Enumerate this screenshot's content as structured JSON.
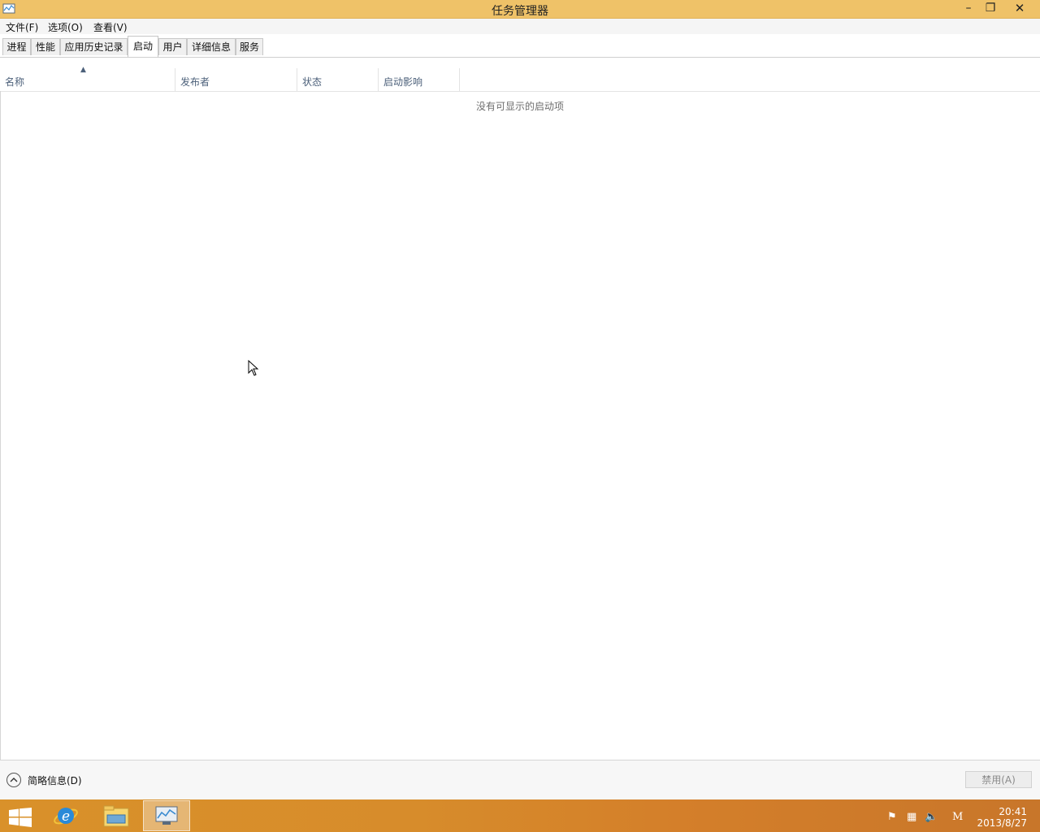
{
  "window": {
    "title": "任务管理器"
  },
  "window_controls": {
    "minimize": "–",
    "maximize": "❐",
    "close": "✕"
  },
  "menu": [
    "文件(F)",
    "选项(O)",
    "查看(V)"
  ],
  "tabs": [
    {
      "label": "进程",
      "active": false
    },
    {
      "label": "性能",
      "active": false
    },
    {
      "label": "应用历史记录",
      "active": false
    },
    {
      "label": "启动",
      "active": true
    },
    {
      "label": "用户",
      "active": false
    },
    {
      "label": "详细信息",
      "active": false
    },
    {
      "label": "服务",
      "active": false
    }
  ],
  "columns": [
    {
      "label": "名称",
      "sorted": "ascending"
    },
    {
      "label": "发布者"
    },
    {
      "label": "状态"
    },
    {
      "label": "启动影响"
    }
  ],
  "empty_message": "没有可显示的启动项",
  "footer": {
    "fewer_details": "简略信息(D)",
    "disable_button": "禁用(A)"
  },
  "taskbar": {
    "apps": [
      "start-icon",
      "internet-explorer-icon",
      "file-explorer-icon",
      "task-manager-icon"
    ],
    "clock_time": "20:41",
    "clock_date": "2013/8/27",
    "tray_letter": "M"
  },
  "colors": {
    "titlebar": "#efc268",
    "taskbar": "#d9912a",
    "header_text": "#4c607a"
  }
}
